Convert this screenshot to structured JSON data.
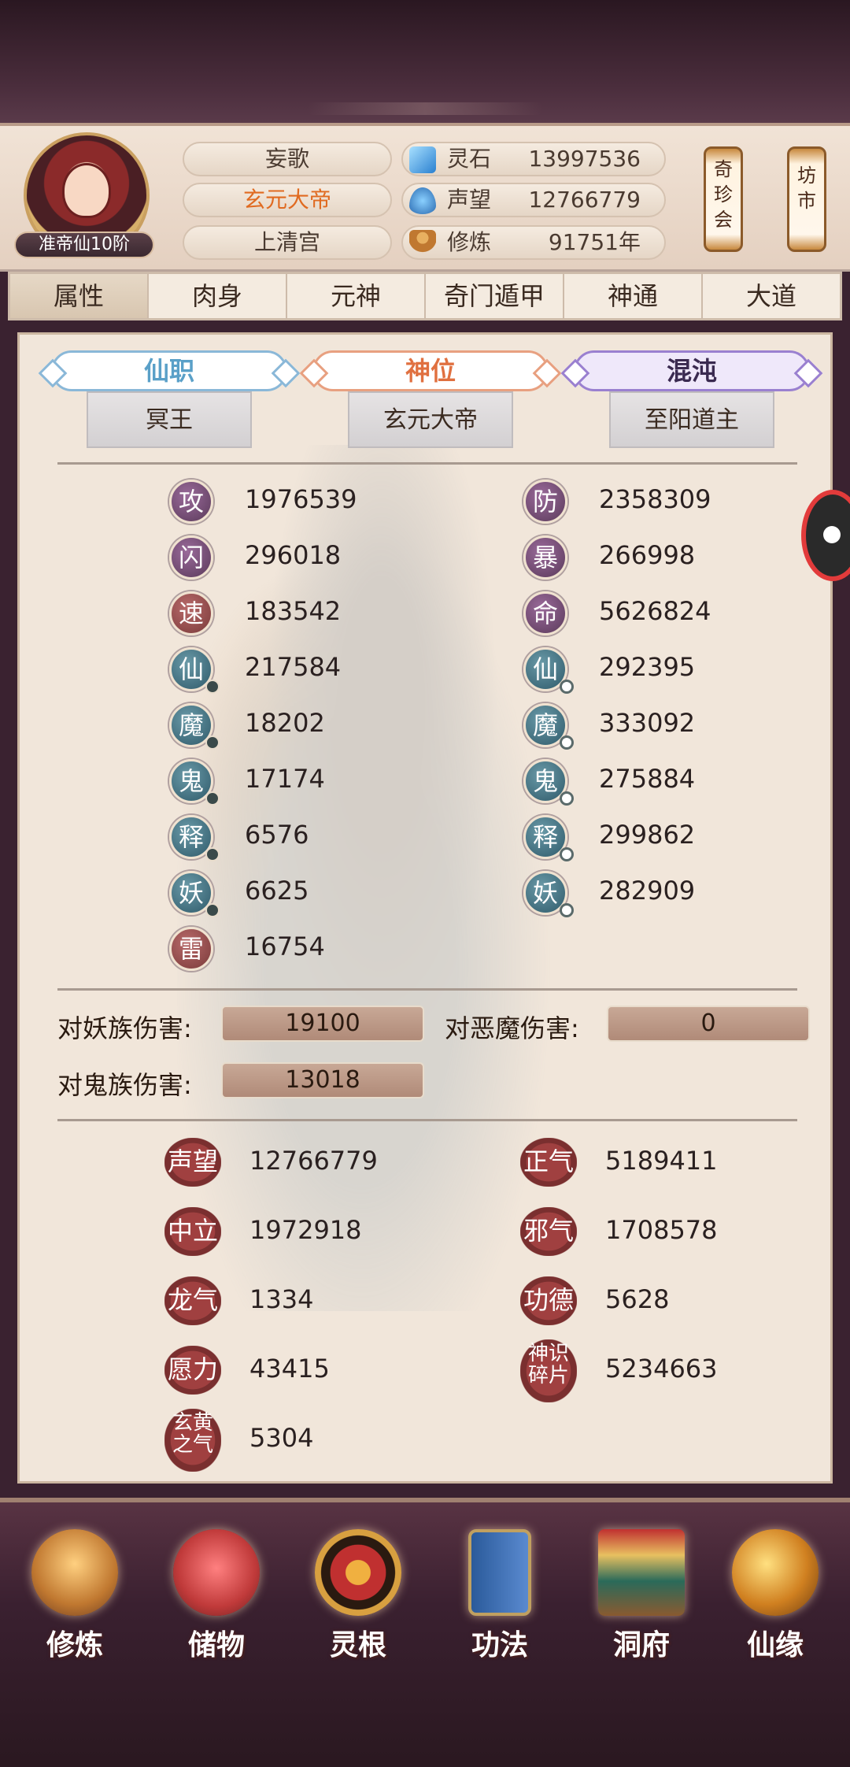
{
  "header": {
    "rank": "准帝仙10阶",
    "name": "妄歌",
    "title": "玄元大帝",
    "sect": "上清宫",
    "resources": [
      {
        "label": "灵石",
        "value": "13997536",
        "icon": "spirit-stone-icon"
      },
      {
        "label": "声望",
        "value": "12766779",
        "icon": "prestige-icon"
      },
      {
        "label": "修炼",
        "value": "91751年",
        "icon": "cultivation-icon"
      }
    ],
    "shops": [
      "奇珍会",
      "坊市"
    ]
  },
  "tabs": [
    "属性",
    "肉身",
    "元神",
    "奇门遁甲",
    "神通",
    "大道"
  ],
  "positions": [
    {
      "label": "仙职",
      "value": "冥王",
      "color": "#5aa0c8"
    },
    {
      "label": "神位",
      "value": "玄元大帝",
      "color": "#e07040"
    },
    {
      "label": "混沌",
      "value": "至阳道主",
      "color": "#7a5ac0"
    }
  ],
  "stats": {
    "left": [
      {
        "label": "攻",
        "value": "1976539"
      },
      {
        "label": "闪",
        "value": "296018"
      },
      {
        "label": "速",
        "value": "183542"
      },
      {
        "label": "仙",
        "value": "217584"
      },
      {
        "label": "魔",
        "value": "18202"
      },
      {
        "label": "鬼",
        "value": "17174"
      },
      {
        "label": "释",
        "value": "6576"
      },
      {
        "label": "妖",
        "value": "6625"
      },
      {
        "label": "雷",
        "value": "16754"
      }
    ],
    "right": [
      {
        "label": "防",
        "value": "2358309"
      },
      {
        "label": "暴",
        "value": "266998"
      },
      {
        "label": "命",
        "value": "5626824"
      },
      {
        "label": "仙",
        "value": "292395"
      },
      {
        "label": "魔",
        "value": "333092"
      },
      {
        "label": "鬼",
        "value": "275884"
      },
      {
        "label": "释",
        "value": "299862"
      },
      {
        "label": "妖",
        "value": "282909"
      }
    ]
  },
  "damage": [
    {
      "label": "对妖族伤害:",
      "value": "19100"
    },
    {
      "label": "对恶魔伤害:",
      "value": "0"
    },
    {
      "label": "对鬼族伤害:",
      "value": "13018"
    }
  ],
  "reputation": {
    "left": [
      {
        "label": "声望",
        "value": "12766779"
      },
      {
        "label": "中立",
        "value": "1972918"
      },
      {
        "label": "龙气",
        "value": "1334"
      },
      {
        "label": "愿力",
        "value": "43415"
      },
      {
        "label": "玄黄之气",
        "value": "5304"
      }
    ],
    "right": [
      {
        "label": "正气",
        "value": "5189411"
      },
      {
        "label": "邪气",
        "value": "1708578"
      },
      {
        "label": "功德",
        "value": "5628"
      },
      {
        "label": "神识碎片",
        "value": "5234663"
      }
    ]
  },
  "nav": [
    "修炼",
    "储物",
    "灵根",
    "功法",
    "洞府",
    "仙缘"
  ]
}
